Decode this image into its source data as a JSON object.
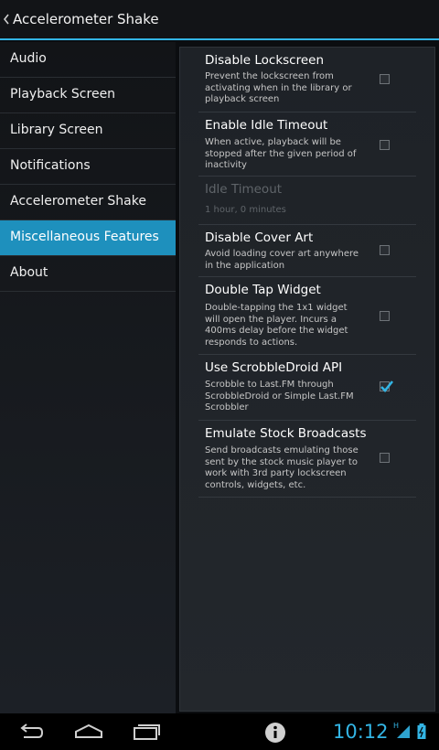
{
  "app_title": "Accelerometer Shake",
  "sidebar": {
    "items": [
      {
        "label": "Audio",
        "selected": false
      },
      {
        "label": "Playback Screen",
        "selected": false
      },
      {
        "label": "Library Screen",
        "selected": false
      },
      {
        "label": "Notifications",
        "selected": false
      },
      {
        "label": "Accelerometer Shake",
        "selected": false
      },
      {
        "label": "Miscellaneous Features",
        "selected": true
      },
      {
        "label": "About",
        "selected": false
      }
    ]
  },
  "prefs": [
    {
      "title": "Disable Lockscreen",
      "summary": "Prevent the lockscreen from activating when in the library or playback screen",
      "checked": false,
      "enabled": true
    },
    {
      "title": "Enable Idle Timeout",
      "summary": "When active, playback will be stopped after the given period of inactivity",
      "checked": false,
      "enabled": true
    },
    {
      "title": "Idle Timeout",
      "summary": "1 hour, 0 minutes",
      "enabled": false
    },
    {
      "title": "Disable Cover Art",
      "summary": "Avoid loading cover art anywhere in the application",
      "checked": false,
      "enabled": true
    },
    {
      "title": "Double Tap Widget",
      "summary": "Double-tapping the 1x1 widget will open the player. Incurs a 400ms delay before the widget responds to actions.",
      "checked": false,
      "enabled": true
    },
    {
      "title": "Use ScrobbleDroid API",
      "summary": "Scrobble to Last.FM through ScrobbleDroid or Simple Last.FM Scrobbler",
      "checked": true,
      "enabled": true
    },
    {
      "title": "Emulate Stock Broadcasts",
      "summary": "Send broadcasts emulating those sent by the stock music player to work with 3rd party lockscreen controls, widgets, etc.",
      "checked": false,
      "enabled": true
    }
  ],
  "status": {
    "time": "10:12",
    "signal": "H"
  },
  "colors": {
    "accent": "#33b5e5",
    "selected_bg": "#1e90bd"
  },
  "icons": {
    "back": "chevron-left-icon",
    "nav_back": "back-arrow-icon",
    "nav_home": "home-icon",
    "nav_recents": "recent-apps-icon",
    "info": "info-icon",
    "signal": "signal-icon",
    "battery": "battery-icon"
  }
}
